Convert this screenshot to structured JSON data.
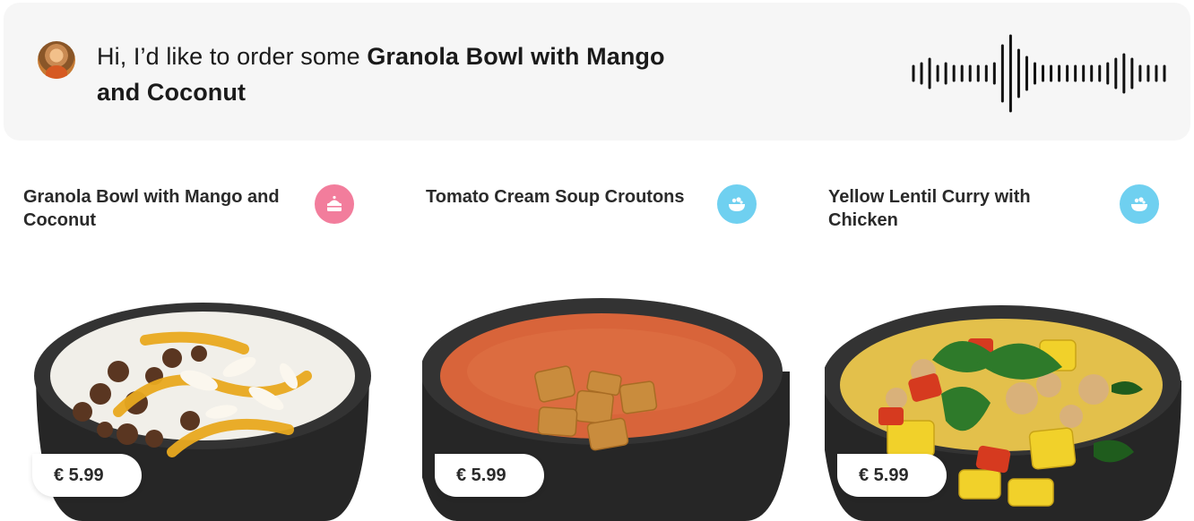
{
  "voice_message": {
    "prefix": "Hi, I’d like to order some ",
    "highlight": "Granola Bowl with Mango and Coconut"
  },
  "products": [
    {
      "title": "Granola Bowl with Mango and Coconut",
      "price": "€ 5.99",
      "category_icon": "cake-icon",
      "badge_color": "#f27d9c"
    },
    {
      "title": "Tomato Cream Soup Croutons",
      "price": "€ 5.99",
      "category_icon": "bowl-icon",
      "badge_color": "#6fd0f0"
    },
    {
      "title": "Yellow Lentil Curry with Chicken",
      "price": "€ 5.99",
      "category_icon": "bowl-icon",
      "badge_color": "#6fd0f0"
    }
  ]
}
